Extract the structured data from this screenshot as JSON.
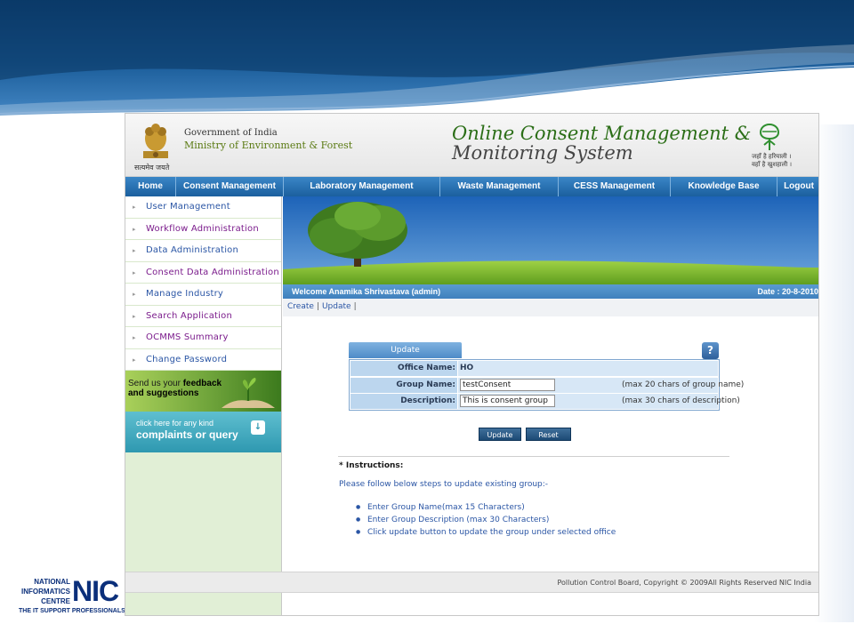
{
  "colors": {
    "nav_blue": "#1b5f9e",
    "sidebar_green": "#e1efd6",
    "welcome_blue": "#3f80bd",
    "link_blue": "#2b56a5",
    "link_purple": "#7b1c8c"
  },
  "header": {
    "gov_line1": "Government of India",
    "gov_line2": "Ministry of Environment & Forest",
    "emblem_motto": "सत्यमेव जयते",
    "title_line1": "Online Consent Management &",
    "title_line2": "Monitoring System",
    "slogan_line1": "जहाँ है हरियाली ।",
    "slogan_line2": "वहाँ है खुशहाली ।"
  },
  "nav": {
    "items": [
      {
        "label": "Home"
      },
      {
        "label": "Consent Management"
      },
      {
        "label": "Laboratory Management"
      },
      {
        "label": "Waste Management"
      },
      {
        "label": "CESS Management"
      },
      {
        "label": "Knowledge Base"
      },
      {
        "label": "Logout"
      }
    ]
  },
  "sidebar": {
    "items": [
      {
        "label": "User Management",
        "icon": "bullet-icon"
      },
      {
        "label": "Workflow Administration",
        "icon": "bullet-icon"
      },
      {
        "label": "Data Administration",
        "icon": "bullet-icon"
      },
      {
        "label": "Consent Data Administration",
        "icon": "bullet-icon"
      },
      {
        "label": "Manage Industry",
        "icon": "bullet-icon"
      },
      {
        "label": "Search Application",
        "icon": "bullet-icon"
      },
      {
        "label": "OCMMS Summary",
        "icon": "bullet-icon"
      },
      {
        "label": "Change Password",
        "icon": "bullet-icon"
      }
    ],
    "feedback_line1_pre": "Send us your ",
    "feedback_line1_bold": "feedback",
    "feedback_line2": "and suggestions",
    "complaint_line1": "click here for any kind",
    "complaint_line2": "complaints or query",
    "complaint_icon": "down-arrow-icon"
  },
  "main": {
    "welcome": "Welcome Anamika Shrivastava (admin)",
    "date": "Date : 20-8-2010",
    "subnav": {
      "create": "Create",
      "update": "Update",
      "sep": "|"
    },
    "form": {
      "tab_label": "Update",
      "help_icon": "?",
      "office_label": "Office Name:",
      "office_value": "HO",
      "group_label": "Group Name:",
      "group_value": "testConsent",
      "group_hint": "(max 20 chars of group name)",
      "desc_label": "Description:",
      "desc_value": "This is consent group",
      "desc_hint": "(max 30 chars of description)",
      "update_button": "Update",
      "reset_button": "Reset"
    },
    "instructions": {
      "title": "* Instructions:",
      "desc": "Please follow below steps to update existing group:-",
      "steps": [
        "Enter Group Name(max 15 Characters)",
        "Enter Group Description (max 30 Characters)",
        "Click update button to update the group under selected office"
      ]
    }
  },
  "footer": {
    "text": "Pollution Control Board, Copyright © 2009All Rights Reserved NIC India"
  },
  "nic": {
    "line1": "NATIONAL",
    "line2": "INFORMATICS",
    "line3": "CENTRE",
    "mark": "NIC",
    "sub": "THE IT SUPPORT PROFESSIONALS"
  }
}
